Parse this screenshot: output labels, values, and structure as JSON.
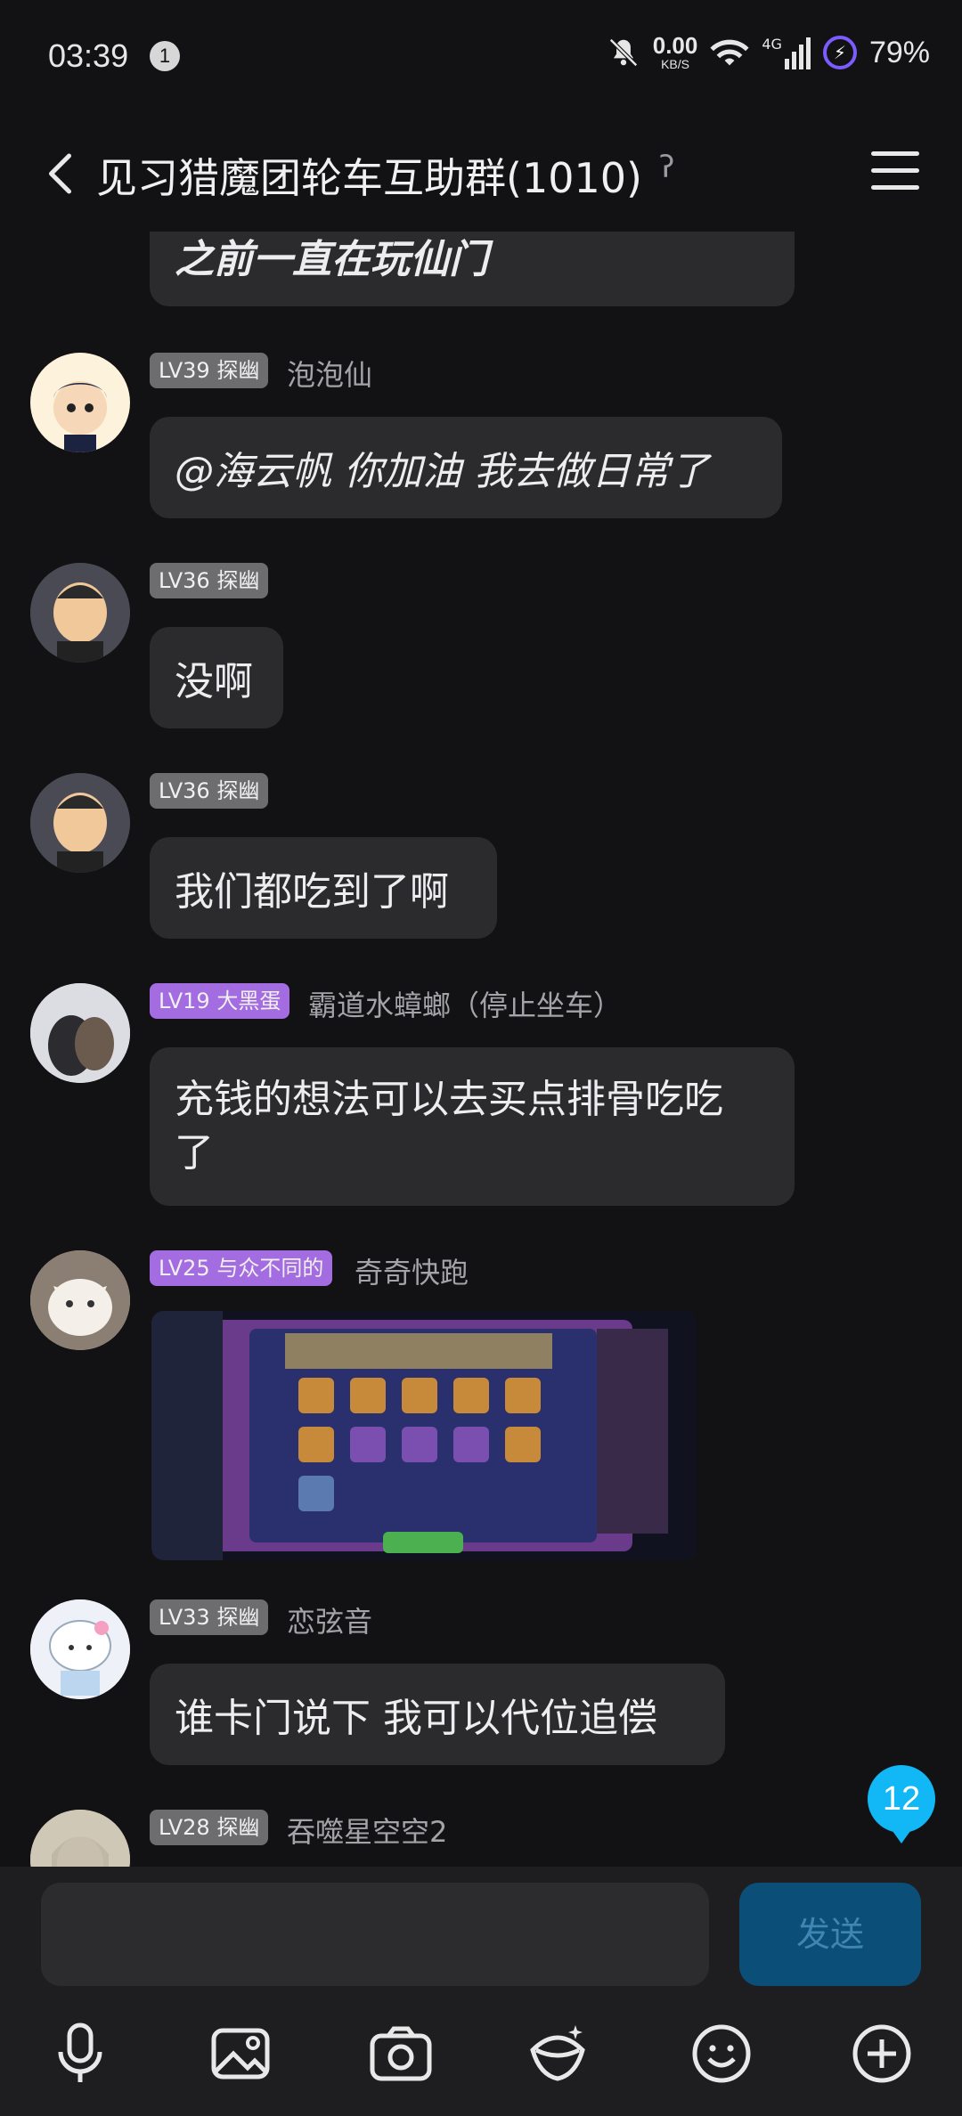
{
  "status_bar": {
    "time": "03:39",
    "notif_count": "1",
    "net_speed": "0.00",
    "net_unit": "KB/S",
    "signal": "4G",
    "battery": "79%"
  },
  "header": {
    "title": "见习猎魔团轮车互助群(1010)"
  },
  "messages": [
    {
      "text": "之前一直在玩仙门"
    },
    {
      "level": "LV39 探幽",
      "name": "泡泡仙",
      "text": "@海云帆 你加油 我去做日常了"
    },
    {
      "level": "LV36 探幽",
      "name": "",
      "text": "没啊"
    },
    {
      "level": "LV36 探幽",
      "name": "",
      "text": "我们都吃到了啊"
    },
    {
      "level": "LV19 大黑蛋",
      "name": "霸道水蟑螂（停止坐车）",
      "text": "充钱的想法可以去买点排骨吃吃了"
    },
    {
      "level": "LV25 与众不同的",
      "name": "奇奇快跑",
      "image": "game-screenshot"
    },
    {
      "level": "LV33 探幽",
      "name": "恋弦音",
      "text": "谁卡门说下 我可以代位追偿"
    },
    {
      "level": "LV28 探幽",
      "name": "吞噬星空空2"
    }
  ],
  "unread_count": "12",
  "input": {
    "placeholder": "",
    "send_label": "发送"
  },
  "toolbar": [
    "mic-icon",
    "image-icon",
    "camera-icon",
    "red-packet-icon",
    "emoji-icon",
    "plus-icon"
  ]
}
